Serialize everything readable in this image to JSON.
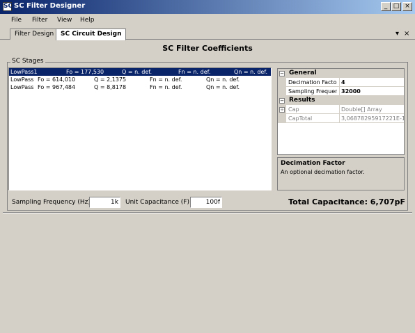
{
  "window": {
    "title": "SC Filter Designer",
    "icon": "SC",
    "buttons": [
      "_",
      "□",
      "×"
    ]
  },
  "menu": [
    "File",
    "Filter",
    "View",
    "Help"
  ],
  "tabs": [
    {
      "label": "Filter Design",
      "active": false
    },
    {
      "label": "SC Circuit Design",
      "active": true
    }
  ],
  "tab_controls": {
    "dropdown": "▾",
    "close": "×"
  },
  "heading": "SC Filter Coefficients",
  "stages": {
    "label": "SC Stages",
    "rows": [
      {
        "name": "LowPass1",
        "fo": "Fo = 177,530",
        "q": "Q = n. def.",
        "fn": "Fn = n. def.",
        "qn": "Qn = n. def.",
        "selected": true
      },
      {
        "name": "LowPass",
        "fo": "Fo = 614,010",
        "q": "Q = 2,1375",
        "fn": "Fn = n. def.",
        "qn": "Qn = n. def.",
        "selected": false
      },
      {
        "name": "LowPass",
        "fo": "Fo = 967,484",
        "q": "Q = 8,8178",
        "fn": "Fn = n. def.",
        "qn": "Qn = n. def.",
        "selected": false
      }
    ]
  },
  "properties": {
    "general": {
      "label": "General",
      "rows": [
        {
          "name": "Decimation Factor",
          "value": "4"
        },
        {
          "name": "Sampling Frequency",
          "value": "32000"
        }
      ]
    },
    "results": {
      "label": "Results",
      "rows": [
        {
          "name": "Cap",
          "value": "Double[] Array"
        },
        {
          "name": "CapTotal",
          "value": "3,06878295917221E-12"
        }
      ]
    }
  },
  "description": {
    "title": "Decimation Factor",
    "text": "An optional decimation factor."
  },
  "inputs": {
    "sampling_label": "Sampling Frequency (Hz):",
    "sampling_value": "1k",
    "unitcap_label": "Unit Capacitance (F):",
    "unitcap_value": "100f"
  },
  "total": "Total Capacitance: 6,707pF",
  "colors": {
    "selection": "#0a246a",
    "face": "#d4d0c8"
  }
}
